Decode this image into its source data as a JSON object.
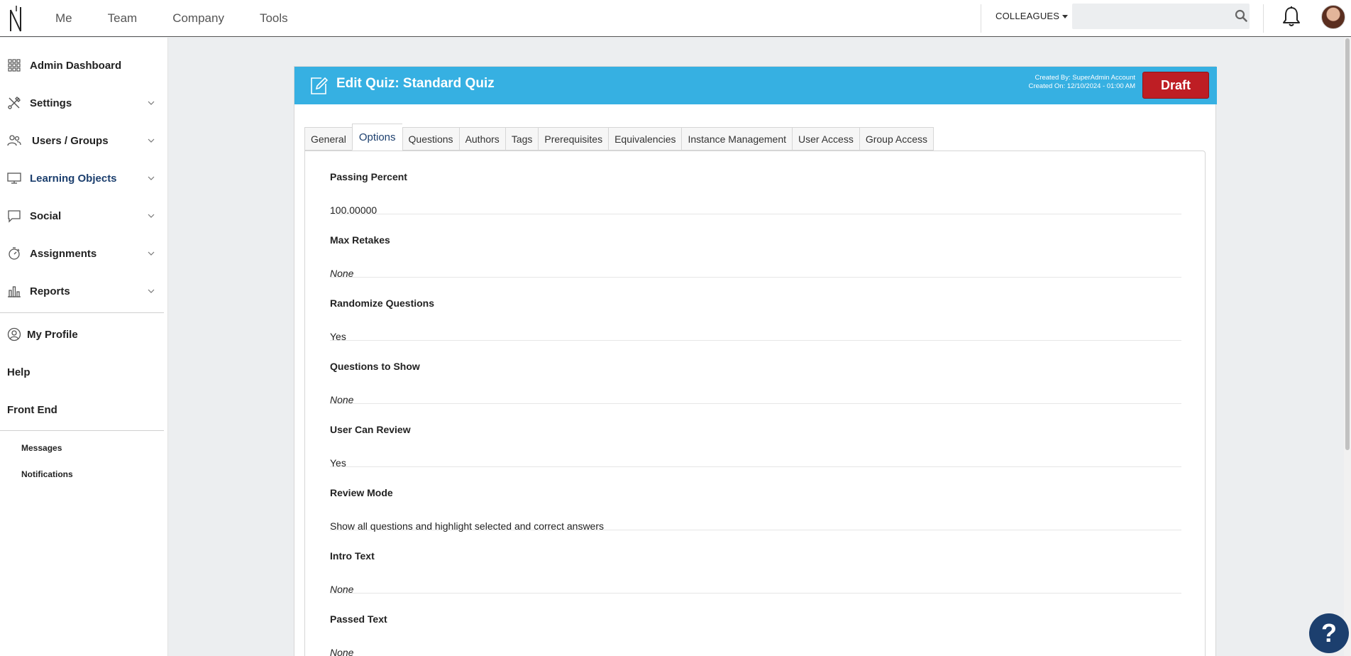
{
  "topnav": {
    "items": [
      "Me",
      "Team",
      "Company",
      "Tools"
    ],
    "colleagues_label": "COLLEAGUES",
    "search_placeholder": ""
  },
  "sidebar": {
    "items": [
      {
        "label": "Admin Dashboard",
        "icon": "grid-icon",
        "expandable": false
      },
      {
        "label": "Settings",
        "icon": "tools-icon",
        "expandable": true
      },
      {
        "label": "Users / Groups",
        "icon": "users-icon",
        "expandable": true
      },
      {
        "label": "Learning Objects",
        "icon": "monitor-icon",
        "expandable": true,
        "active": true
      },
      {
        "label": "Social",
        "icon": "speech-bubble-icon",
        "expandable": true
      },
      {
        "label": "Assignments",
        "icon": "stopwatch-icon",
        "expandable": true
      },
      {
        "label": "Reports",
        "icon": "bar-chart-icon",
        "expandable": true
      }
    ],
    "my_profile": "My Profile",
    "help": "Help",
    "front_end": "Front End",
    "messages": "Messages",
    "notifications": "Notifications"
  },
  "card": {
    "title": "Edit Quiz: Standard Quiz",
    "created_by": "Created By: SuperAdmin Account",
    "created_on": "Created On: 12/10/2024 - 01:00 AM",
    "status_button": "Draft"
  },
  "tabs": [
    {
      "label": "General"
    },
    {
      "label": "Options",
      "active": true
    },
    {
      "label": "Questions"
    },
    {
      "label": "Authors"
    },
    {
      "label": "Tags"
    },
    {
      "label": "Prerequisites"
    },
    {
      "label": "Equivalencies"
    },
    {
      "label": "Instance Management"
    },
    {
      "label": "User Access"
    },
    {
      "label": "Group Access"
    }
  ],
  "fields": [
    {
      "label": "Passing Percent",
      "value": "100.00000",
      "italic": false
    },
    {
      "label": "Max Retakes",
      "value": "None",
      "italic": true
    },
    {
      "label": "Randomize Questions",
      "value": "Yes",
      "italic": false
    },
    {
      "label": "Questions to Show",
      "value": "None",
      "italic": true
    },
    {
      "label": "User Can Review",
      "value": "Yes",
      "italic": false
    },
    {
      "label": "Review Mode",
      "value": "Show all questions and highlight selected and correct answers",
      "italic": false
    },
    {
      "label": "Intro Text",
      "value": "None",
      "italic": true
    },
    {
      "label": "Passed Text",
      "value": "None",
      "italic": true
    }
  ],
  "help_button": "?",
  "colors": {
    "header": "#36b0e2",
    "draft": "#be1e24",
    "accent": "#1c3f6e"
  }
}
